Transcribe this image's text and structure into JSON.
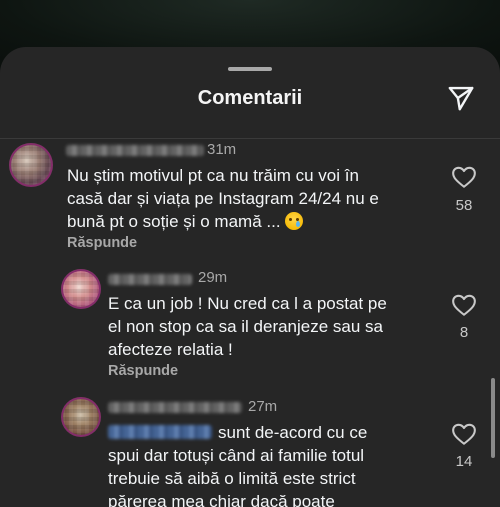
{
  "sheet": {
    "title": "Comentarii"
  },
  "icons": {
    "share": "send-paper-plane-icon",
    "like": "heart-outline-icon",
    "emoji": "crying-face-emoji"
  },
  "colors": {
    "sheet_bg": "#262626",
    "text": "#f3f5f7",
    "muted": "#a8a8a8",
    "mention": "#4a6fa8"
  },
  "comments": [
    {
      "time": "31m",
      "lines": [
        "Nu știm motivul pt ca nu trăim cu voi în",
        "casă dar și viața pe Instagram 24/24 nu e",
        "bună pt o soție și o mamă ..."
      ],
      "reply_label": "Răspunde",
      "likes": "58"
    },
    {
      "time": "29m",
      "lines": [
        "E ca un job ! Nu cred ca l a postat pe",
        "el non stop ca sa il deranjeze sau sa",
        "afecteze relatia !"
      ],
      "reply_label": "Răspunde",
      "likes": "8"
    },
    {
      "time": "27m",
      "lines": [
        "sunt de-acord cu ce",
        "spui dar totuși când ai familie totul",
        "trebuie să aibă o limită este strict",
        "părerea mea chiar dacă  poate"
      ],
      "likes": "14"
    }
  ]
}
